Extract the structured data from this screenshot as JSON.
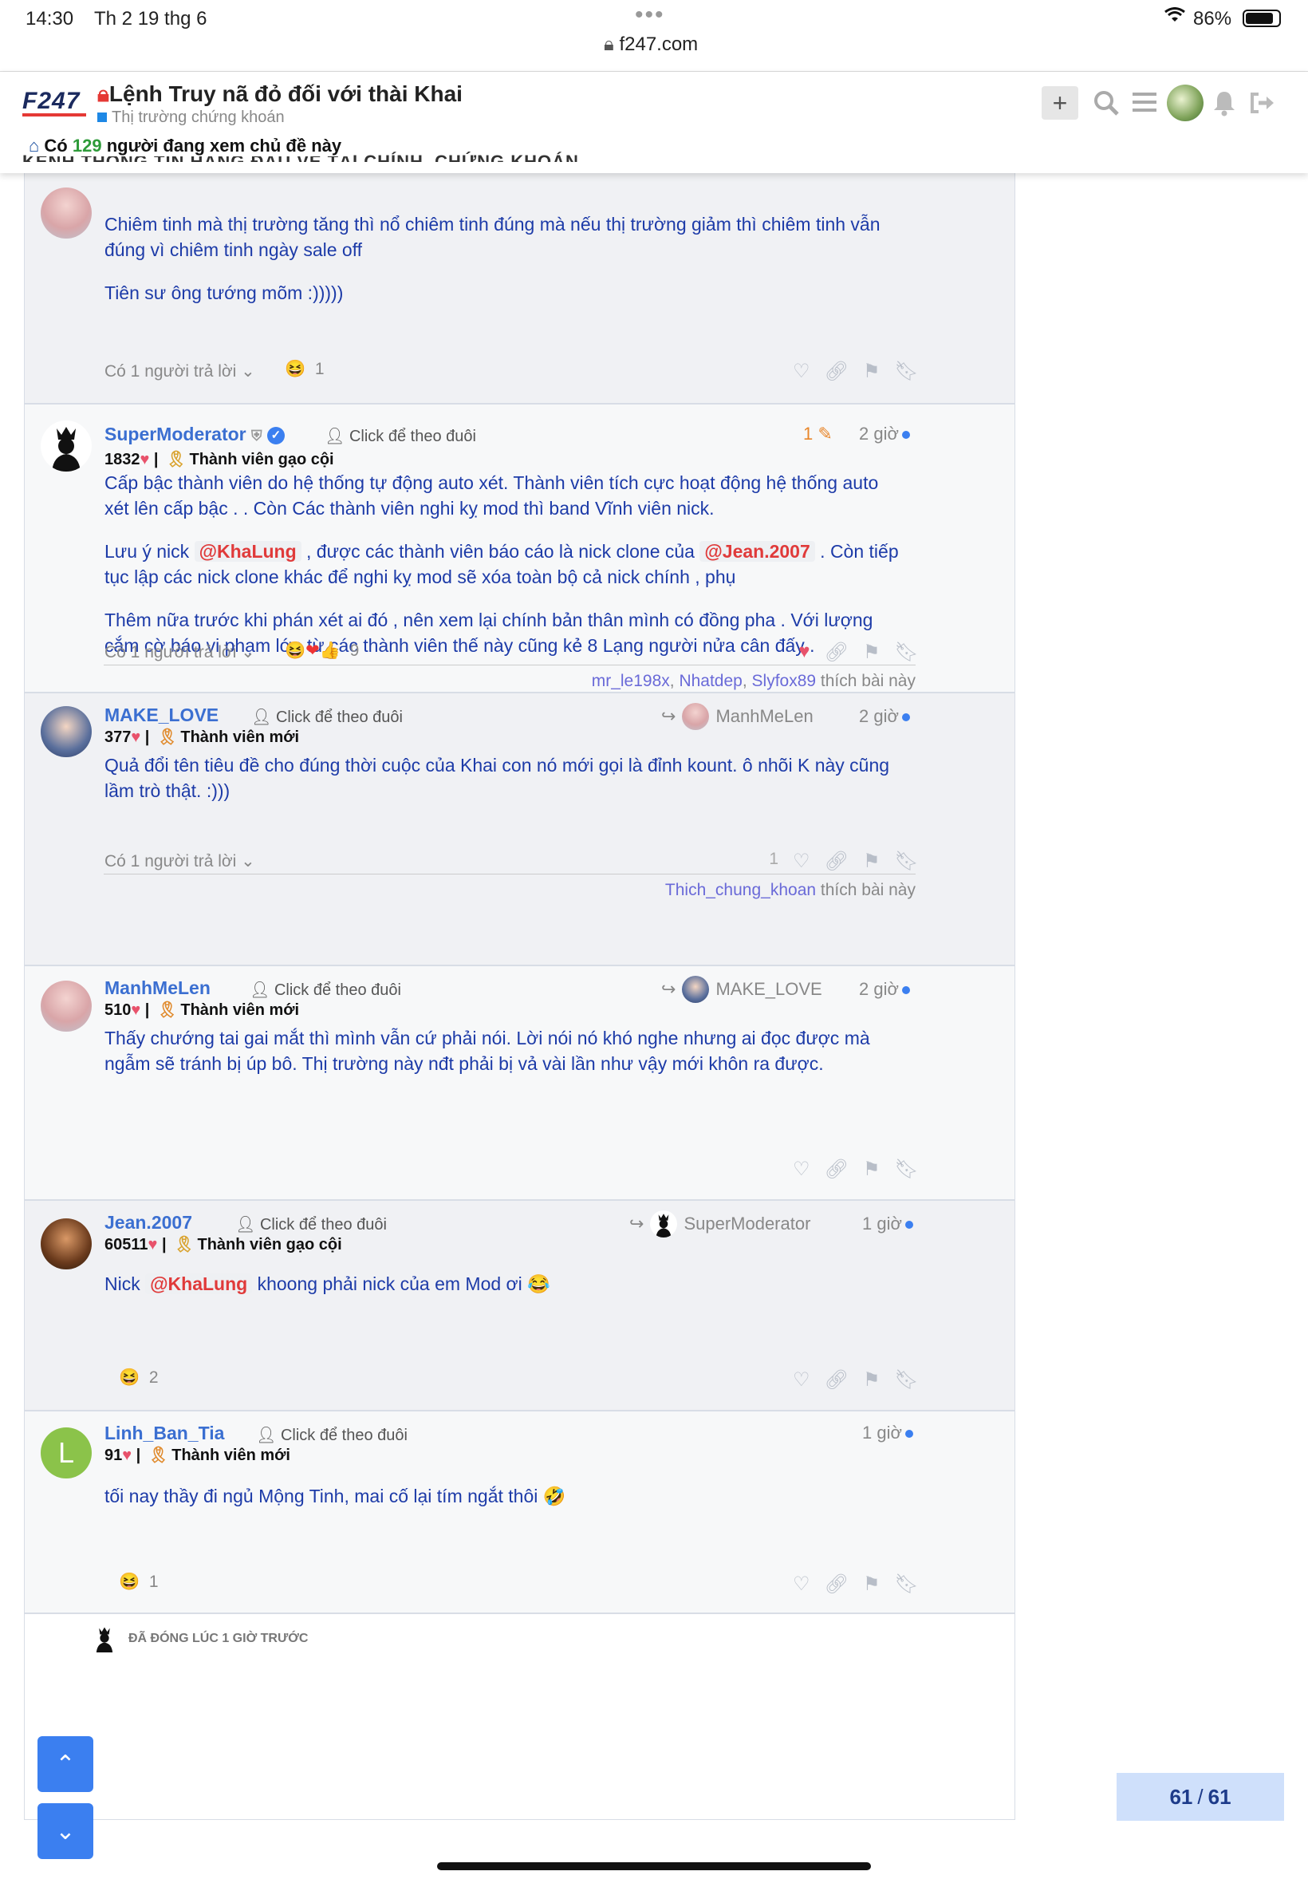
{
  "status_bar": {
    "time": "14:30",
    "date": "Th 2 19 thg 6",
    "url": "f247.com",
    "battery": "86%"
  },
  "header": {
    "logo": "F247",
    "title": "Lệnh Truy nã đỏ đối với thài Khai",
    "category": "Thị trường chứng khoán",
    "viewers_prefix": "Có",
    "viewers_count": "129",
    "viewers_suffix": "người đang xem chủ đề này",
    "banner_text": "KÊNH THÔNG TIN HÀNG ĐẦU VỀ TÀI CHÍNH, CHỨNG KHOÁN"
  },
  "common": {
    "follow_label": "Click để theo đuôi"
  },
  "posts": [
    {
      "body": [
        "Chiêm tinh mà thị trường tăng thì nổ chiêm tinh đúng mà nếu thị trường giảm thì chiêm tinh vẫn đúng vì chiêm tinh ngày sale off",
        "Tiên sư ông tướng mõm :)))))"
      ],
      "replies": "Có 1 người trả lời",
      "reactions": "1"
    },
    {
      "username": "SuperModerator",
      "points": "1832",
      "rank": "Thành viên gạo cội",
      "edit_count": "1",
      "time": "2 giờ",
      "body_1": "Cấp bậc thành viên do hệ thống tự động auto xét. Thành viên tích cực hoạt động hệ thống auto xét lên cấp bậc . . Còn Các thành viên nghi kỵ mod thì band Vĩnh viên nick.",
      "body_2a": "Lưu ý nick",
      "mention_1": "@KhaLung",
      "body_2b": ", được các thành viên báo cáo là nick clone của",
      "mention_2": "@Jean.2007",
      "body_2c": ". Còn tiếp tục lập các nick clone khác để nghi kỵ mod sẽ xóa toàn bộ cả nick chính , phụ",
      "body_3": "Thêm nữa trước khi phán xét ai đó , nên xem lại chính bản thân mình có đồng pha . Với lượng cắm cờ báo vi phạm lớn từ các thành viên thế này cũng kẻ 8 Lạng người nửa cân đấy .",
      "replies": "Có 1 người trả lời",
      "reactions": "9",
      "likes_users": [
        "mr_le198x",
        "Nhatdep",
        "Slyfox89"
      ],
      "likes_suffix": "thích bài này"
    },
    {
      "username": "MAKE_LOVE",
      "points": "377",
      "rank": "Thành viên mới",
      "reply_to": "ManhMeLen",
      "time": "2 giờ",
      "body": "Quả đổi tên tiêu đề cho đúng thời cuộc của Khai con nó mới gọi là đỉnh kount. ô nhõi K này cũng lầm trò thật. :)))",
      "replies": "Có 1 người trả lời",
      "like_count": "1",
      "likes_users": [
        "Thich_chung_khoan"
      ],
      "likes_suffix": "thích bài này"
    },
    {
      "username": "ManhMeLen",
      "points": "510",
      "rank": "Thành viên mới",
      "reply_to": "MAKE_LOVE",
      "time": "2 giờ",
      "body": "Thấy chướng tai gai mắt thì mình vẫn cứ phải nói. Lời nói nó khó nghe nhưng ai đọc được mà ngẫm sẽ tránh bị úp bô. Thị trường này nđt phải bị vả vài lần như vậy mới khôn ra được."
    },
    {
      "username": "Jean.2007",
      "points": "60511",
      "rank": "Thành viên gạo cội",
      "reply_to": "SuperModerator",
      "time": "1 giờ",
      "body_a": "Nick",
      "mention": "@KhaLung",
      "body_b": "khoong phải nick của em Mod ơi",
      "reactions": "2"
    },
    {
      "username": "Linh_Ban_Tia",
      "avatar_letter": "L",
      "points": "91",
      "rank": "Thành viên mới",
      "time": "1 giờ",
      "body": "tối nay thầy đi ngủ Mộng Tinh, mai cố lại tím ngắt thôi",
      "reactions": "1"
    }
  ],
  "closed_notice": "ĐÃ ĐÓNG LÚC 1 GIỜ TRƯỚC",
  "pager": {
    "current": "61",
    "sep": "/",
    "total": "61"
  },
  "colors": {
    "accent": "#3b7ff0",
    "username": "#3b6fd1",
    "body_text": "#1d3ba8",
    "mention": "#e03a3a",
    "heart": "#e8526b",
    "pager_bg": "#cfe0fb"
  }
}
